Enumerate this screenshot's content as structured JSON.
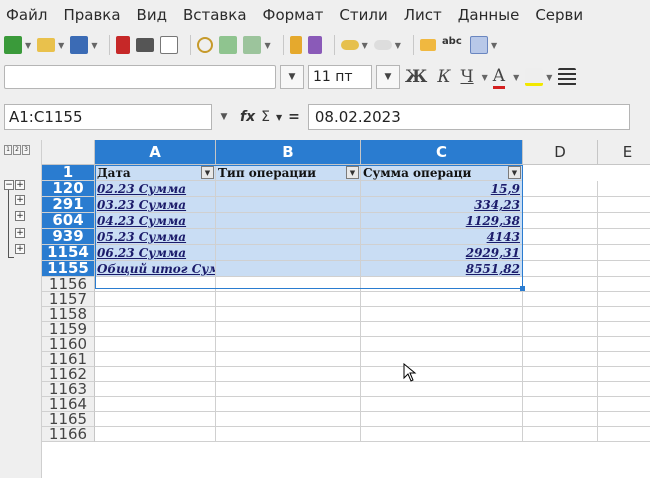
{
  "menu": [
    "Файл",
    "Правка",
    "Вид",
    "Вставка",
    "Формат",
    "Стили",
    "Лист",
    "Данные",
    "Серви"
  ],
  "toolbar": {
    "font_size": "11 пт",
    "bold": "Ж",
    "italic": "К",
    "underline": "Ч",
    "font_color": "A",
    "icons": [
      "new-document-icon",
      "open-folder-icon",
      "save-icon",
      "export-pdf-icon",
      "print-icon",
      "print-preview-icon",
      "cut-icon",
      "copy-icon",
      "paste-icon",
      "clone-format-icon",
      "clear-format-icon",
      "undo-icon",
      "redo-icon",
      "find-replace-icon",
      "spellcheck-icon",
      "rows-icon"
    ]
  },
  "formula": {
    "name_box": "A1:C1155",
    "fx": "fx",
    "sum": "Σ",
    "equals": "=",
    "content": "08.02.2023"
  },
  "outline_levels": [
    "1",
    "2",
    "3"
  ],
  "columns": [
    "A",
    "B",
    "C",
    "D",
    "E"
  ],
  "header_row": {
    "row_number": "1",
    "a": "Дата",
    "b": "Тип операции",
    "c": "Сумма операци"
  },
  "rows": [
    {
      "row": "120",
      "a": "02.23 Сумма",
      "c": "15,9"
    },
    {
      "row": "291",
      "a": "03.23 Сумма",
      "c": "334,23"
    },
    {
      "row": "604",
      "a": "04.23 Сумма",
      "c": "1129,38"
    },
    {
      "row": "939",
      "a": "05.23 Сумма",
      "c": "4143"
    },
    {
      "row": "1154",
      "a": "06.23 Сумма",
      "c": "2929,31"
    },
    {
      "row": "1155",
      "a": "Общий итог Сумма",
      "c": "8551,82"
    }
  ],
  "empty_rows": [
    "1156",
    "1157",
    "1158",
    "1159",
    "1160",
    "1161",
    "1162",
    "1163",
    "1164",
    "1165",
    "1166"
  ],
  "colors": {
    "selection": "#2a7cd0",
    "selection_fill": "#c9ddf4"
  }
}
